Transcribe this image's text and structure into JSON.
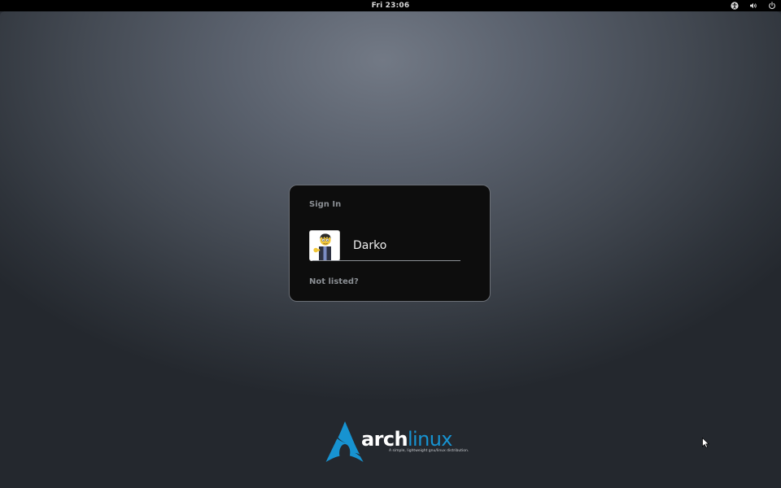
{
  "top_bar": {
    "clock": "Fri 23:06",
    "icons": [
      "accessibility-icon",
      "volume-icon",
      "power-icon"
    ]
  },
  "login": {
    "title": "Sign In",
    "users": [
      {
        "name": "Darko",
        "avatar": "cartoon-avatar"
      }
    ],
    "not_listed": "Not listed?"
  },
  "branding": {
    "logo_word_1": "arch",
    "logo_word_2": "linux",
    "tagline": "A simple, lightweight gnu/linux distribution.",
    "accent_color": "#1793d1"
  }
}
